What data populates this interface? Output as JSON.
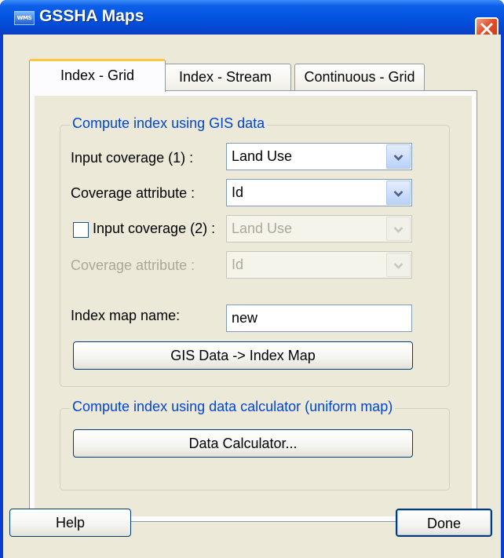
{
  "window": {
    "title": "GSSHA Maps",
    "icon_text": "WMS"
  },
  "tabs": [
    {
      "label": "Index - Grid",
      "active": true
    },
    {
      "label": "Index - Stream",
      "active": false
    },
    {
      "label": "Continuous - Grid",
      "active": false
    }
  ],
  "gis_group": {
    "legend": "Compute index using GIS data",
    "input_coverage_1": {
      "label": "Input coverage (1) :",
      "value": "Land Use"
    },
    "coverage_attribute_1": {
      "label": "Coverage attribute :",
      "value": "Id"
    },
    "input_coverage_2": {
      "label": "Input coverage (2) :",
      "value": "Land Use",
      "checked": false,
      "enabled": false
    },
    "coverage_attribute_2": {
      "label": "Coverage attribute :",
      "value": "Id",
      "enabled": false
    },
    "index_map_name": {
      "label": "Index map name:",
      "value": "new"
    },
    "compute_button": "GIS Data -> Index Map"
  },
  "calc_group": {
    "legend": "Compute index using data calculator (uniform map)",
    "button": "Data Calculator..."
  },
  "footer": {
    "help_button": "Help",
    "done_button": "Done"
  },
  "colors": {
    "titlebar": "#0252e0",
    "dialog_bg": "#ece9d8",
    "group_title": "#0046d5",
    "active_tab_highlight": "#ffc83c",
    "disabled_text": "#aca899"
  }
}
